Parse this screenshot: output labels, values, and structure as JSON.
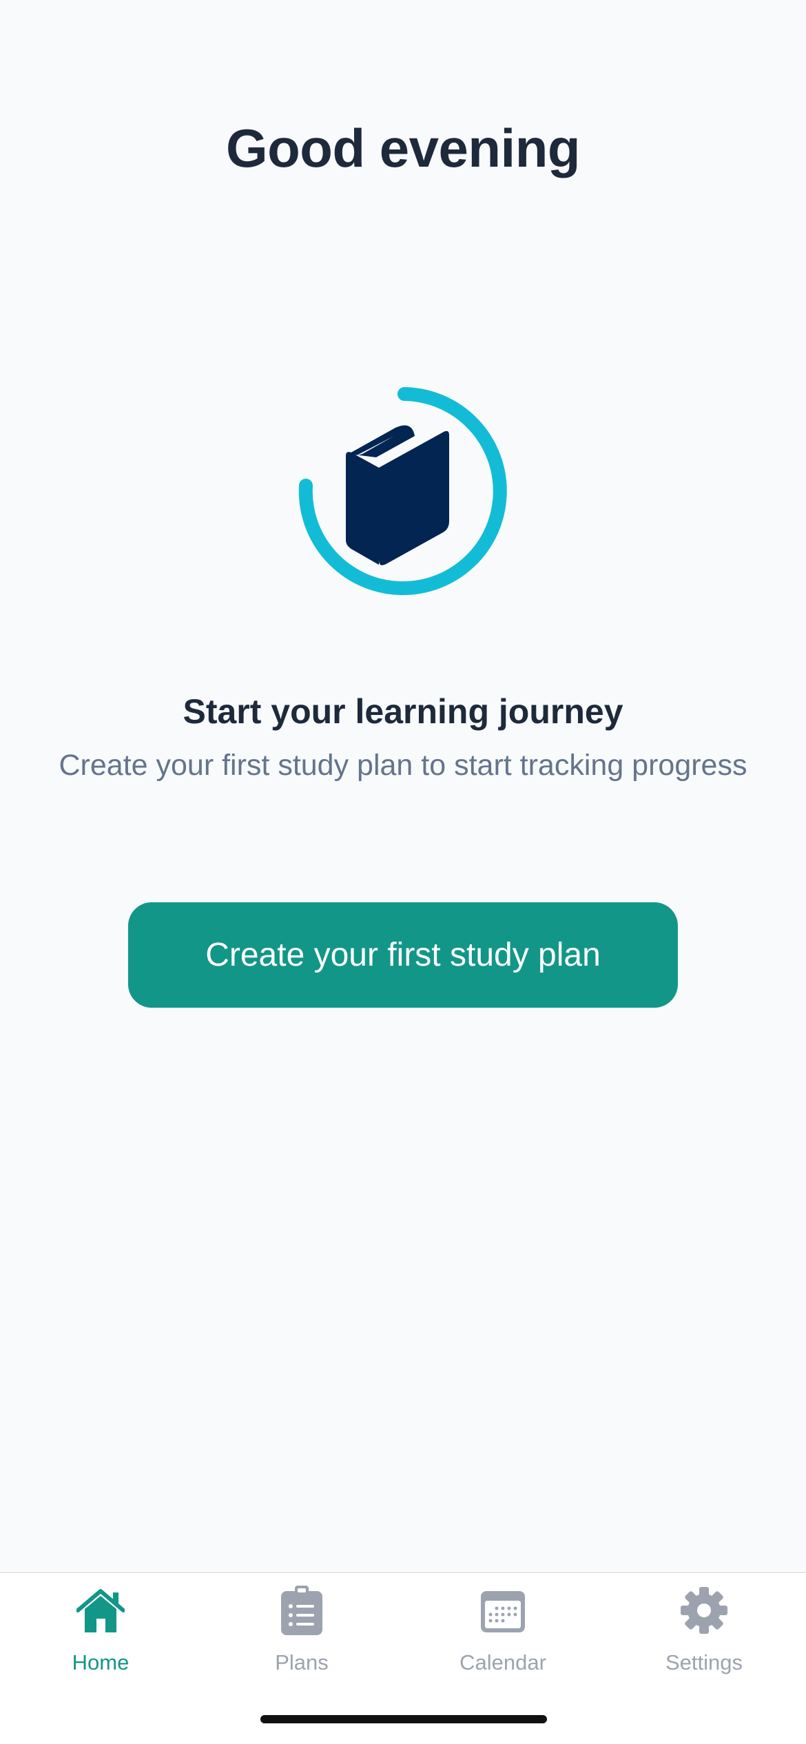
{
  "header": {
    "greeting": "Good evening"
  },
  "empty_state": {
    "icon": "book-progress-icon",
    "title": "Start your learning journey",
    "subtitle": "Create your first study plan to start tracking progress"
  },
  "cta": {
    "label": "Create your first study plan"
  },
  "tabs": [
    {
      "label": "Home",
      "icon": "home-icon",
      "active": true
    },
    {
      "label": "Plans",
      "icon": "clipboard-list-icon",
      "active": false
    },
    {
      "label": "Calendar",
      "icon": "calendar-icon",
      "active": false
    },
    {
      "label": "Settings",
      "icon": "gear-icon",
      "active": false
    }
  ],
  "colors": {
    "background": "#f8fafc",
    "accent": "#129688",
    "ring": "#13bcd6",
    "book": "#022552",
    "text_primary": "#1e293b",
    "text_secondary": "#64748b",
    "tab_inactive": "#9ca3af"
  }
}
